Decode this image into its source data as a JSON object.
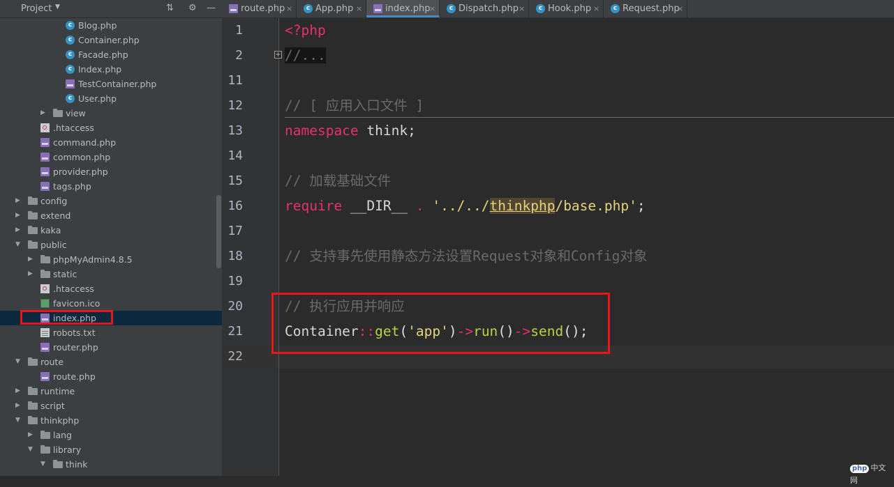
{
  "sidebar": {
    "title": "Project",
    "tree": [
      {
        "label": "Blog.php",
        "icon": "c"
      },
      {
        "label": "Container.php",
        "icon": "c"
      },
      {
        "label": "Facade.php",
        "icon": "c"
      },
      {
        "label": "Index.php",
        "icon": "c"
      },
      {
        "label": "TestContainer.php",
        "icon": "php"
      },
      {
        "label": "User.php",
        "icon": "c"
      },
      {
        "label": "view",
        "icon": "folder"
      },
      {
        "label": ".htaccess",
        "icon": "htaccess"
      },
      {
        "label": "command.php",
        "icon": "php"
      },
      {
        "label": "common.php",
        "icon": "php"
      },
      {
        "label": "provider.php",
        "icon": "php"
      },
      {
        "label": "tags.php",
        "icon": "php"
      },
      {
        "label": "config",
        "icon": "folder"
      },
      {
        "label": "extend",
        "icon": "folder"
      },
      {
        "label": "kaka",
        "icon": "folder"
      },
      {
        "label": "public",
        "icon": "folder"
      },
      {
        "label": "phpMyAdmin4.8.5",
        "icon": "folder"
      },
      {
        "label": "static",
        "icon": "folder"
      },
      {
        "label": ".htaccess",
        "icon": "htaccess"
      },
      {
        "label": "favicon.ico",
        "icon": "ico"
      },
      {
        "label": "index.php",
        "icon": "php"
      },
      {
        "label": "robots.txt",
        "icon": "txt"
      },
      {
        "label": "router.php",
        "icon": "php"
      },
      {
        "label": "route",
        "icon": "folder"
      },
      {
        "label": "route.php",
        "icon": "php"
      },
      {
        "label": "runtime",
        "icon": "folder"
      },
      {
        "label": "script",
        "icon": "folder"
      },
      {
        "label": "thinkphp",
        "icon": "folder"
      },
      {
        "label": "lang",
        "icon": "folder"
      },
      {
        "label": "library",
        "icon": "folder"
      },
      {
        "label": "think",
        "icon": "folder"
      }
    ]
  },
  "tabs": [
    {
      "label": "route.php",
      "icon": "php"
    },
    {
      "label": "App.php",
      "icon": "c"
    },
    {
      "label": "index.php",
      "icon": "php"
    },
    {
      "label": "Dispatch.php",
      "icon": "c"
    },
    {
      "label": "Hook.php",
      "icon": "c"
    },
    {
      "label": "Request.php",
      "icon": "c"
    }
  ],
  "editor": {
    "line_numbers": [
      "1",
      "2",
      "11",
      "12",
      "13",
      "14",
      "15",
      "16",
      "17",
      "18",
      "19",
      "20",
      "21",
      "22"
    ],
    "code": {
      "l1": "<?php",
      "l2": "//...",
      "l12": "// [ 应用入口文件 ]",
      "l13_kw": "namespace",
      "l13_rest": " think;",
      "l15": "// 加载基础文件",
      "l16_kw": "require",
      "l16_dir": " __DIR__ ",
      "l16_dot": ".",
      "l16_str_a": " '../../",
      "l16_str_b": "thinkphp",
      "l16_str_c": "/base.php'",
      "l16_end": ";",
      "l18": "// 支持事先使用静态方法设置Request对象和Config对象",
      "l20": "// 执行应用并响应",
      "l21_cls": "Container",
      "l21_op1": "::",
      "l21_fn1": "get",
      "l21_p1": "(",
      "l21_str": "'app'",
      "l21_p2": ")",
      "l21_op2": "->",
      "l21_fn2": "run",
      "l21_p3": "()",
      "l21_op3": "->",
      "l21_fn3": "send",
      "l21_p4": "();"
    }
  },
  "watermark": {
    "logo": "php",
    "text": "中文网"
  }
}
